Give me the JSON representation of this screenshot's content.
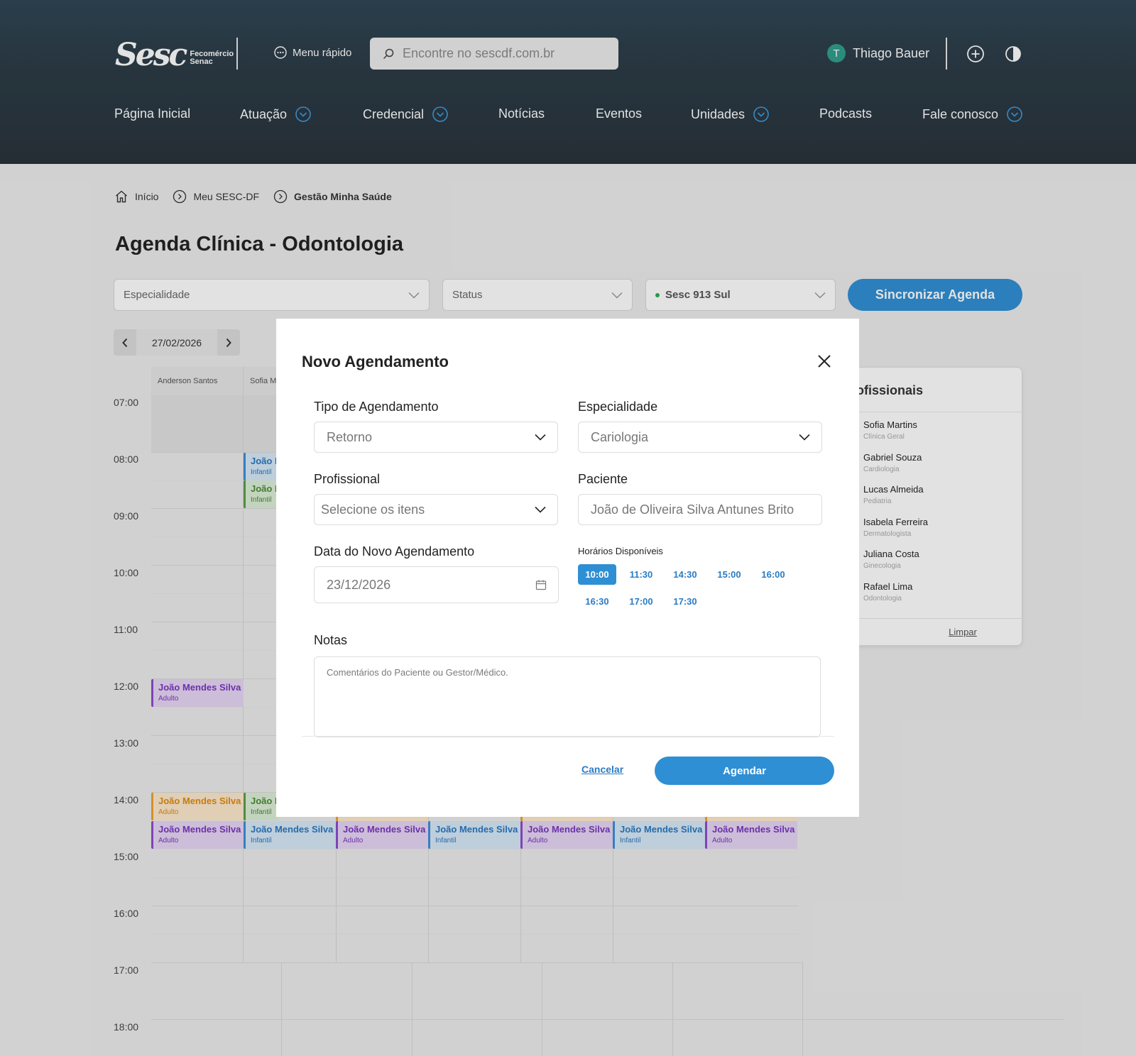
{
  "header": {
    "logo_text": "Sesc",
    "logo_sub1": "Fecomércio",
    "logo_sub2": "Senac",
    "menu_rapido": "Menu rápido",
    "search_placeholder": "Encontre no sescdf.com.br",
    "user_initial": "T",
    "user_name": "Thiago Bauer"
  },
  "nav": [
    {
      "label": "Página Inicial",
      "dropdown": false
    },
    {
      "label": "Atuação",
      "dropdown": true
    },
    {
      "label": "Credencial",
      "dropdown": true
    },
    {
      "label": "Notícias",
      "dropdown": false
    },
    {
      "label": "Eventos",
      "dropdown": false
    },
    {
      "label": "Unidades",
      "dropdown": true
    },
    {
      "label": "Podcasts",
      "dropdown": false
    },
    {
      "label": "Fale conosco",
      "dropdown": true
    }
  ],
  "breadcrumb": [
    "Início",
    "Meu SESC-DF",
    "Gestão Minha Saúde"
  ],
  "page_title": "Agenda Clínica - Odontologia",
  "filters": {
    "especialidade": "Especialidade",
    "status": "Status",
    "unidade": "Sesc 913 Sul",
    "sync_button": "Sincronizar Agenda"
  },
  "date_nav": {
    "date": "27/02/2026"
  },
  "calendar": {
    "times": [
      "07:00",
      "08:00",
      "09:00",
      "10:00",
      "11:00",
      "12:00",
      "13:00",
      "14:00",
      "15:00",
      "16:00",
      "17:00",
      "18:00"
    ],
    "columns": [
      "Anderson Santos",
      "Sofia M"
    ],
    "appointments": [
      {
        "name": "João I",
        "tag": "Infantil",
        "color": "blue"
      },
      {
        "name": "João I",
        "tag": "Infantil",
        "color": "green"
      },
      {
        "name": "João Mendes Silva",
        "tag": "Adulto",
        "color": "purple"
      },
      {
        "name": "João Mendes Silva",
        "tag": "Adulto",
        "color": "orange"
      },
      {
        "name": "João I",
        "tag": "Infantil",
        "color": "green"
      },
      {
        "name": "João Mendes Silva",
        "tag": "Adulto",
        "color": "purple"
      },
      {
        "name": "João Mendes Silva",
        "tag": "Infantil",
        "color": "blue"
      },
      {
        "name": "João Mendes Silva",
        "tag": "Adulto",
        "color": "purple"
      },
      {
        "name": "João Mendes Silva",
        "tag": "Infantil",
        "color": "blue"
      },
      {
        "name": "João Mendes Silva",
        "tag": "Adulto",
        "color": "purple"
      },
      {
        "name": "João Mendes Silva",
        "tag": "Infantil",
        "color": "blue"
      },
      {
        "name": "João Mendes Silva",
        "tag": "Adulto",
        "color": "purple"
      }
    ]
  },
  "side_panel": {
    "title": "ofissionais",
    "professionals": [
      {
        "name": "Sofia Martins",
        "specialty": "Clínica Geral"
      },
      {
        "name": "Gabriel Souza",
        "specialty": "Cardiologia"
      },
      {
        "name": "Lucas Almeida",
        "specialty": "Pediatria"
      },
      {
        "name": "Isabela Ferreira",
        "specialty": "Dermatologista"
      },
      {
        "name": "Juliana Costa",
        "specialty": "Ginecologia"
      },
      {
        "name": "Rafael Lima",
        "specialty": "Odontologia"
      }
    ],
    "clear": "Limpar"
  },
  "modal": {
    "title": "Novo Agendamento",
    "tipo_label": "Tipo de Agendamento",
    "tipo_value": "Retorno",
    "especialidade_label": "Especialidade",
    "especialidade_value": "Cariologia",
    "profissional_label": "Profissional",
    "profissional_placeholder": "Selecione os itens",
    "paciente_label": "Paciente",
    "paciente_value": "João de Oliveira Silva Antunes Brito",
    "data_label": "Data do Novo Agendamento",
    "data_value": "23/12/2026",
    "horarios_label": "Horários Disponíveis",
    "horarios": [
      "10:00",
      "11:30",
      "14:30",
      "15:00",
      "16:00",
      "16:30",
      "17:00",
      "17:30"
    ],
    "horario_selected": "10:00",
    "notas_label": "Notas",
    "notas_placeholder": "Comentários do Paciente ou Gestor/Médico.",
    "cancel": "Cancelar",
    "submit": "Agendar"
  },
  "colors": {
    "primary": "#2f8fd4",
    "header_bg": "#2b3b46",
    "purple": "#8c4ad0",
    "blue": "#3c8fd8",
    "green": "#5a9e48",
    "orange": "#f0a12c"
  }
}
